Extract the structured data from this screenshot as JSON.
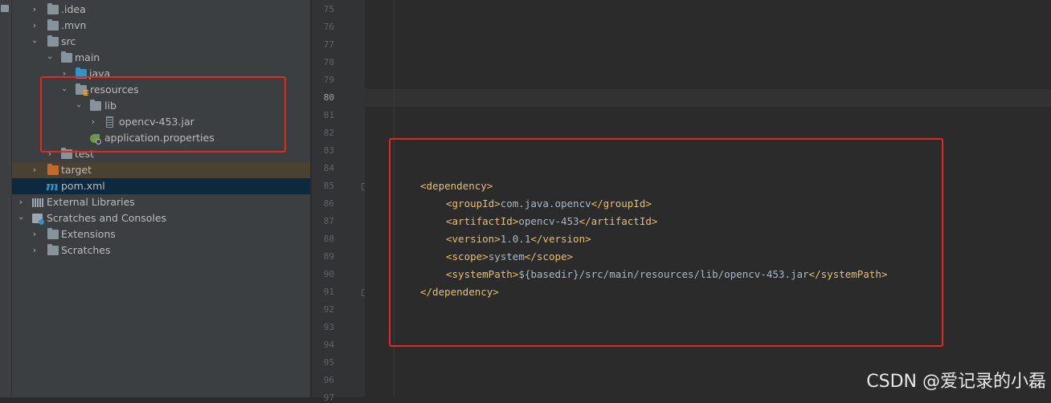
{
  "tree": {
    "items": [
      {
        "label": ".idea",
        "icon": "folder-icon"
      },
      {
        "label": ".mvn",
        "icon": "folder-icon"
      },
      {
        "label": "src",
        "icon": "folder-icon"
      },
      {
        "label": "main",
        "icon": "folder-icon"
      },
      {
        "label": "java",
        "icon": "source-folder-icon"
      },
      {
        "label": "resources",
        "icon": "resources-folder-icon"
      },
      {
        "label": "lib",
        "icon": "folder-icon"
      },
      {
        "label": "opencv-453.jar",
        "icon": "jar-icon"
      },
      {
        "label": "application.properties",
        "icon": "spring-properties-icon"
      },
      {
        "label": "test",
        "icon": "folder-icon"
      },
      {
        "label": "target",
        "icon": "excluded-folder-icon"
      },
      {
        "label": "pom.xml",
        "icon": "maven-icon"
      },
      {
        "label": "External Libraries",
        "icon": "libraries-icon"
      },
      {
        "label": "Scratches and Consoles",
        "icon": "scratches-icon"
      },
      {
        "label": "Extensions",
        "icon": "folder-icon"
      },
      {
        "label": "Scratches",
        "icon": "folder-icon"
      }
    ]
  },
  "editor": {
    "line_numbers": [
      "75",
      "76",
      "77",
      "78",
      "79",
      "80",
      "81",
      "82",
      "83",
      "84",
      "85",
      "86",
      "87",
      "88",
      "89",
      "90",
      "91",
      "92",
      "93",
      "94",
      "95",
      "96",
      "97"
    ],
    "current_line": "80",
    "code": [
      {
        "open": "<dependency>",
        "text": "",
        "close": ""
      },
      {
        "open": "<groupId>",
        "text": "com.java.opencv",
        "close": "</groupId>"
      },
      {
        "open": "<artifactId>",
        "text": "opencv-453",
        "close": "</artifactId>"
      },
      {
        "open": "<version>",
        "text": "1.0.1",
        "close": "</version>"
      },
      {
        "open": "<scope>",
        "text": "system",
        "close": "</scope>"
      },
      {
        "open": "<systemPath>",
        "text": "${basedir}/src/main/resources/lib/opencv-453.jar",
        "close": "</systemPath>"
      },
      {
        "open": "</dependency>",
        "text": "",
        "close": ""
      }
    ]
  },
  "watermark": "CSDN @爱记录的小磊",
  "colors": {
    "annotation": "#e3291e",
    "xml_tag": "#e8bf6a",
    "text": "#a9b7c6",
    "tree_bg": "#3c3f41",
    "editor_bg": "#2b2b2b"
  }
}
